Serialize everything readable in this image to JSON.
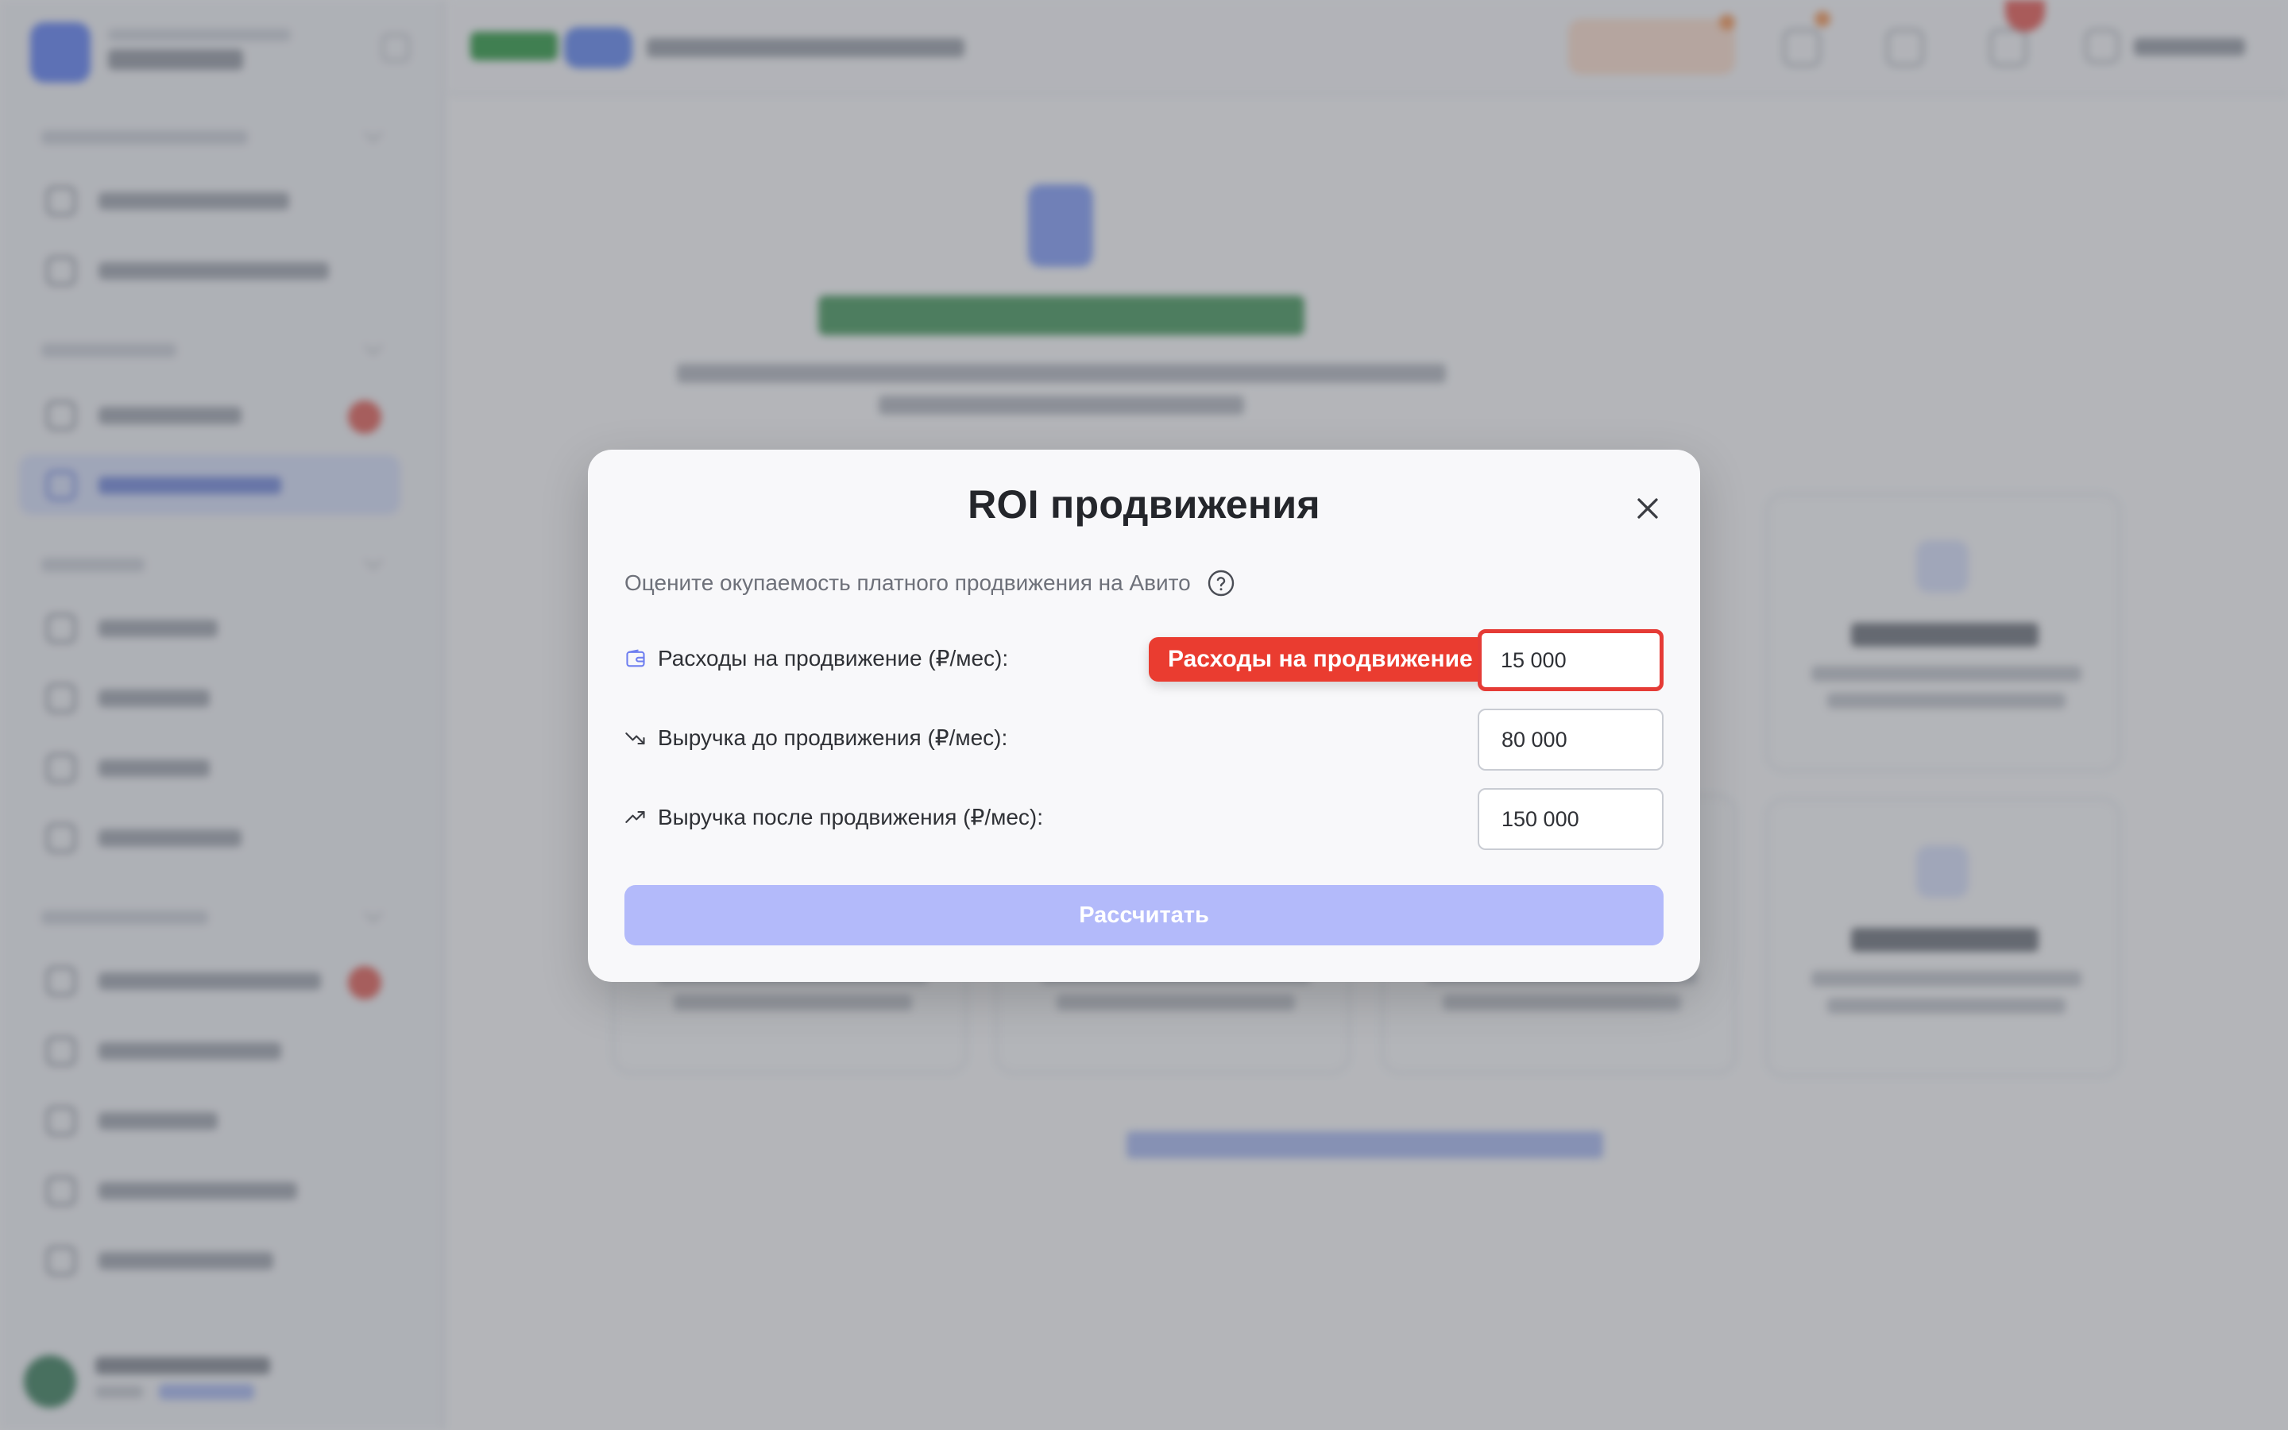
{
  "modal": {
    "title": "ROI продвижения",
    "description": "Оцените окупаемость платного продвижения на Авито",
    "help_icon": "question-circle-icon",
    "close_icon": "close-icon",
    "fields": [
      {
        "label": "Расходы на продвижение (₽/мес):",
        "icon": "wallet-icon",
        "value": "15 000",
        "focused": true
      },
      {
        "label": "Выручка до продвижения (₽/мес):",
        "icon": "trending-down-icon",
        "value": "80 000"
      },
      {
        "label": "Выручка после продвижения (₽/мес):",
        "icon": "trending-up-icon",
        "value": "150 000"
      }
    ],
    "tooltip": "Расходы на продвижение",
    "submit_label": "Рассчитать"
  },
  "colors": {
    "accent": "#b3bafa",
    "tooltip": "#ea3c30",
    "focus_border": "#e53b36",
    "modal_bg": "#f8f8fa",
    "overlay": "rgba(60,62,70,0.35)"
  }
}
